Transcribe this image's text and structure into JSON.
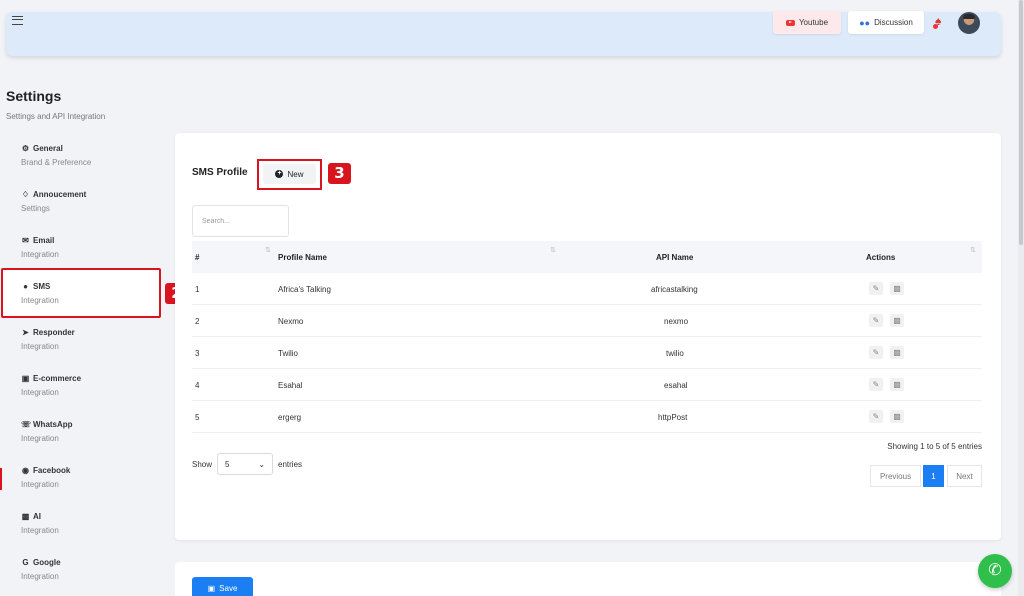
{
  "topbar": {
    "youtube_label": "Youtube",
    "discussion_label": "Discussion"
  },
  "page": {
    "title": "Settings",
    "subtitle": "Settings and API Integration"
  },
  "sidebar": {
    "items": [
      {
        "title": "General",
        "sub": "Brand & Preference",
        "icon": "gear-icon"
      },
      {
        "title": "Annoucement",
        "sub": "Settings",
        "icon": "bell-icon"
      },
      {
        "title": "Email",
        "sub": "Integration",
        "icon": "envelope-icon"
      },
      {
        "title": "SMS",
        "sub": "Integration",
        "icon": "chat-icon"
      },
      {
        "title": "Responder",
        "sub": "Integration",
        "icon": "paper-plane-icon"
      },
      {
        "title": "E-commerce",
        "sub": "Integration",
        "icon": "cart-icon"
      },
      {
        "title": "WhatsApp",
        "sub": "Integration",
        "icon": "whatsapp-icon"
      },
      {
        "title": "Facebook",
        "sub": "Integration",
        "icon": "facebook-icon"
      },
      {
        "title": "AI",
        "sub": "Integration",
        "icon": "robot-icon"
      },
      {
        "title": "Google",
        "sub": "Integration",
        "icon": "google-icon"
      }
    ]
  },
  "annotations": {
    "badge2": "2",
    "badge3": "3"
  },
  "card": {
    "title": "SMS Profile",
    "new_label": "New",
    "search_placeholder": "Search..."
  },
  "table": {
    "columns": [
      "#",
      "Profile Name",
      "API Name",
      "Actions"
    ],
    "rows": [
      {
        "n": "1",
        "profile": "Africa's Talking",
        "api": "africastalking"
      },
      {
        "n": "2",
        "profile": "Nexmo",
        "api": "nexmo"
      },
      {
        "n": "3",
        "profile": "Twilio",
        "api": "twilio"
      },
      {
        "n": "4",
        "profile": "Esahal",
        "api": "esahal"
      },
      {
        "n": "5",
        "profile": "ergerg",
        "api": "httpPost"
      }
    ]
  },
  "footer": {
    "show_label": "Show",
    "entries_value": "5",
    "entries_label": "entries",
    "showing_text": "Showing 1 to 5 of 5 entries",
    "prev_label": "Previous",
    "page_label": "1",
    "next_label": "Next"
  },
  "save_label": "Save",
  "colors": {
    "accent": "#1b7ef2",
    "annotation": "#d8141f"
  }
}
